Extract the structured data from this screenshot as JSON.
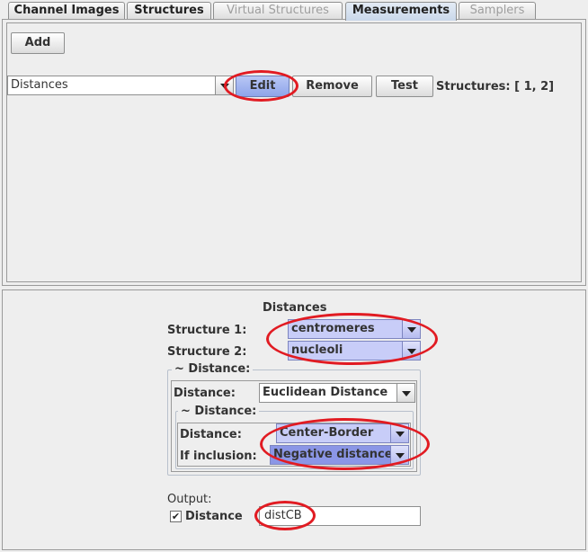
{
  "tabs": [
    {
      "label": "Channel Images",
      "state": "normal"
    },
    {
      "label": "Structures",
      "state": "normal"
    },
    {
      "label": "Virtual Structures",
      "state": "disabled"
    },
    {
      "label": "Measurements",
      "state": "active"
    },
    {
      "label": "Samplers",
      "state": "disabled"
    }
  ],
  "measurements": {
    "add_label": "Add",
    "selected": "Distances",
    "edit_label": "Edit",
    "remove_label": "Remove",
    "test_label": "Test",
    "structures_text": "Structures: [ 1, 2]"
  },
  "editor": {
    "title": "Distances",
    "structure1_label": "Structure 1:",
    "structure1_value": "centromeres",
    "structure2_label": "Structure 2:",
    "structure2_value": "nucleoli",
    "distance_group_title": "~ Distance:",
    "distance_label": "Distance:",
    "distance_value": "Euclidean Distance",
    "sub_group_title": "~ Distance:",
    "sub_distance_label": "Distance:",
    "sub_distance_value": "Center-Border",
    "inclusion_label": "If inclusion:",
    "inclusion_value": "Negative distance",
    "output_label": "Output:",
    "output_checkbox_label": "Distance",
    "output_checked": true,
    "output_value": "distCB"
  },
  "colors": {
    "highlight_ring": "#e11b22",
    "selected_combo": "#c8cdf8",
    "selected_button": "#8ea4ea"
  }
}
